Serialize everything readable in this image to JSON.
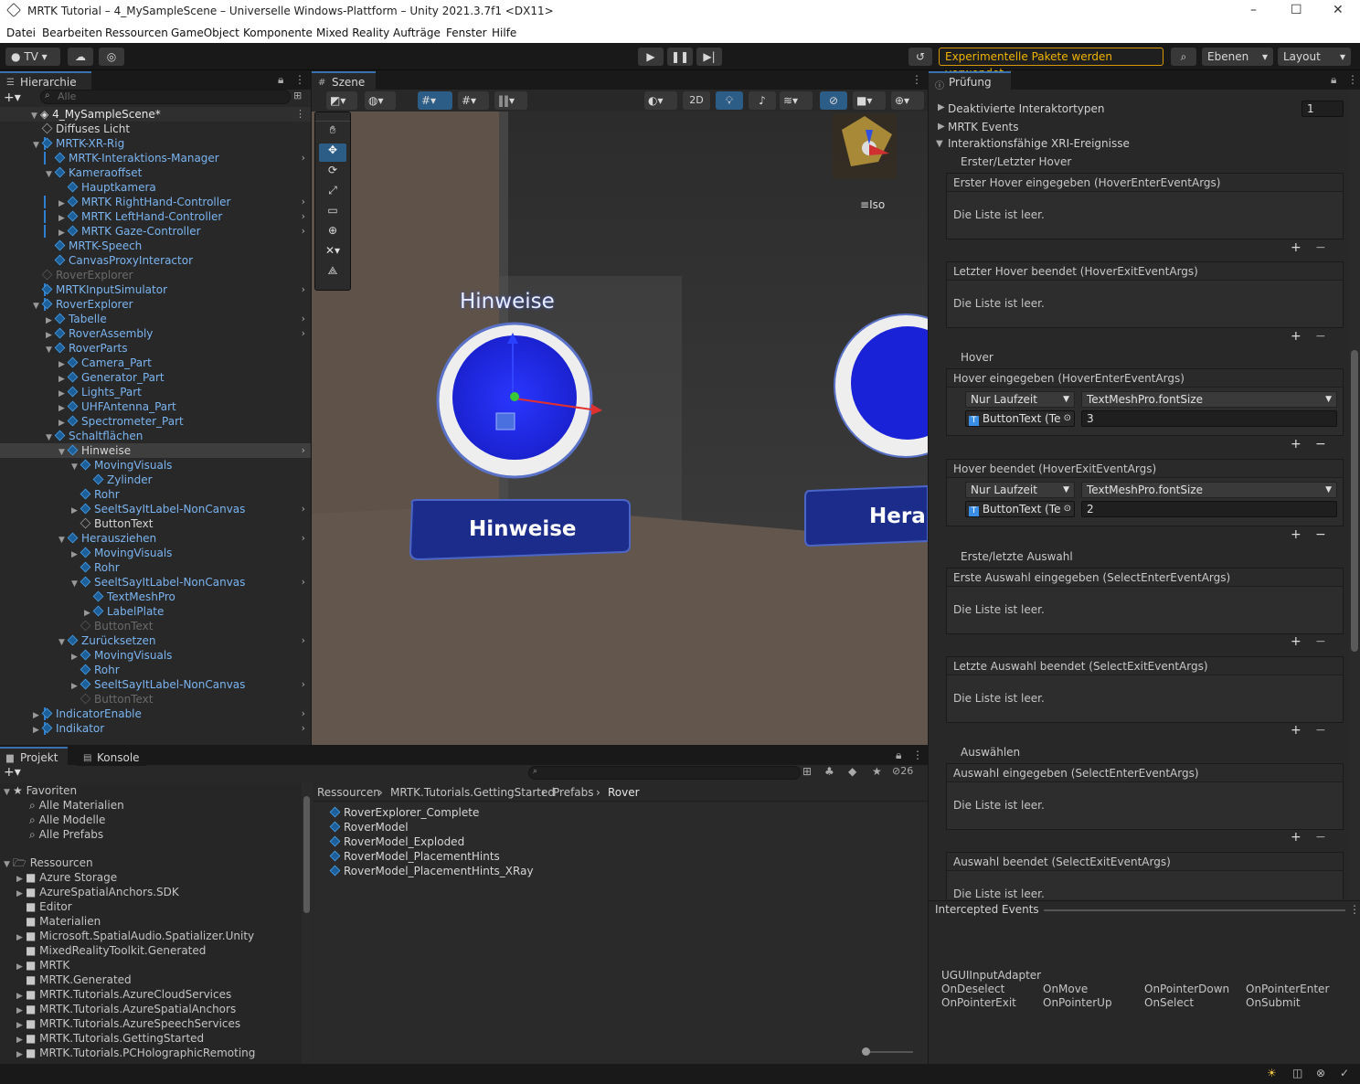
{
  "window": {
    "title": "MRTK Tutorial – 4_MySampleScene – Universelle Windows-Plattform – Unity 2021.3.7f1 <DX11>",
    "min": "–",
    "max": "☐",
    "close": "✕"
  },
  "menu": [
    "Datei",
    "Bearbeiten",
    "Ressourcen",
    "GameObject",
    "Komponente",
    "Mixed Reality",
    "Aufträge",
    "Fenster",
    "Hilfe"
  ],
  "toolbar": {
    "account": "TV",
    "warning": "Experimentelle Pakete werden verwendet",
    "layers": "Ebenen",
    "layout": "Layout"
  },
  "hierarchy": {
    "tab": "Hierarchie",
    "search_placeholder": "Alle",
    "scene": "4_MySampleScene*",
    "items": [
      {
        "label": "Diffuses Licht",
        "style": "normal"
      },
      {
        "label": "MRTK-XR-Rig",
        "style": "blue"
      },
      {
        "label": "MRTK-Interaktions-Manager",
        "style": "blue"
      },
      {
        "label": "Kameraoffset",
        "style": "blue"
      },
      {
        "label": "Hauptkamera",
        "style": "blue"
      },
      {
        "label": "MRTK RightHand-Controller",
        "style": "blue"
      },
      {
        "label": "MRTK LeftHand-Controller",
        "style": "blue"
      },
      {
        "label": "MRTK Gaze-Controller",
        "style": "blue"
      },
      {
        "label": "MRTK-Speech",
        "style": "blue"
      },
      {
        "label": "CanvasProxyInteractor",
        "style": "blue"
      },
      {
        "label": "RoverExplorer",
        "style": "dim"
      },
      {
        "label": "MRTKInputSimulator",
        "style": "blue"
      },
      {
        "label": "RoverExplorer",
        "style": "blue"
      },
      {
        "label": "Tabelle",
        "style": "blue"
      },
      {
        "label": "RoverAssembly",
        "style": "blue"
      },
      {
        "label": "RoverParts",
        "style": "blue"
      },
      {
        "label": "Camera_Part",
        "style": "blue"
      },
      {
        "label": "Generator_Part",
        "style": "blue"
      },
      {
        "label": "Lights_Part",
        "style": "blue"
      },
      {
        "label": "UHFAntenna_Part",
        "style": "blue"
      },
      {
        "label": "Spectrometer_Part",
        "style": "blue"
      },
      {
        "label": "Schaltflächen",
        "style": "blue"
      },
      {
        "label": "Hinweise",
        "style": "normal"
      },
      {
        "label": "MovingVisuals",
        "style": "blue"
      },
      {
        "label": "Zylinder",
        "style": "blue"
      },
      {
        "label": "Rohr",
        "style": "blue"
      },
      {
        "label": "SeeltSayItLabel-NonCanvas",
        "style": "blue"
      },
      {
        "label": "ButtonText",
        "style": "normal"
      },
      {
        "label": "Herausziehen",
        "style": "blue"
      },
      {
        "label": "MovingVisuals",
        "style": "blue"
      },
      {
        "label": "Rohr",
        "style": "blue"
      },
      {
        "label": "SeeltSayItLabel-NonCanvas",
        "style": "blue"
      },
      {
        "label": "TextMeshPro",
        "style": "blue"
      },
      {
        "label": "LabelPlate",
        "style": "blue"
      },
      {
        "label": "ButtonText",
        "style": "dim"
      },
      {
        "label": "Zurücksetzen",
        "style": "blue"
      },
      {
        "label": "MovingVisuals",
        "style": "blue"
      },
      {
        "label": "Rohr",
        "style": "blue"
      },
      {
        "label": "SeeltSayItLabel-NonCanvas",
        "style": "blue"
      },
      {
        "label": "ButtonText",
        "style": "dim"
      },
      {
        "label": "IndicatorEnable",
        "style": "blue"
      },
      {
        "label": "Indikator",
        "style": "blue"
      }
    ]
  },
  "scene": {
    "tab": "Szene",
    "mode_2d": "2D",
    "iso": "Iso",
    "label_top": "Hinweise",
    "button_label": "Hinweise",
    "button_label_2": "Hera"
  },
  "inspector": {
    "tab": "Prüfung",
    "deactivated": "Deaktivierte Interaktortypen",
    "deactivated_value": "1",
    "events": "MRTK Events",
    "xri": "Interaktionsfähige XRI-Ereignisse",
    "group1": "Erster/Letzter Hover",
    "box1": "Erster Hover eingegeben (HoverEnterEventArgs)",
    "empty": "Die Liste ist leer.",
    "box2": "Letzter Hover beendet (HoverExitEventArgs)",
    "group2": "Hover",
    "box3": "Hover eingegeben (HoverEnterEventArgs)",
    "runtime": "Nur Laufzeit",
    "func": "TextMeshPro.fontSize",
    "target": "ButtonText (Te",
    "val3": "3",
    "box4": "Hover beendet (HoverExitEventArgs)",
    "val4": "2",
    "group3": "Erste/letzte Auswahl",
    "box5": "Erste Auswahl eingegeben (SelectEnterEventArgs)",
    "box6": "Letzte Auswahl beendet (SelectExitEventArgs)",
    "group4": "Auswählen",
    "box7": "Auswahl eingegeben (SelectEnterEventArgs)",
    "box8": "Auswahl beendet (SelectExitEventArgs)",
    "plus": "+",
    "minus": "−",
    "intercepted": "Intercepted Events",
    "adapter": "UGUIInputAdapter",
    "event_names": [
      "OnDeselect",
      "OnMove",
      "OnPointerDown",
      "OnPointerEnter",
      "OnPointerExit",
      "OnPointerUp",
      "OnSelect",
      "OnSubmit"
    ]
  },
  "project": {
    "tab_project": "Projekt",
    "tab_console": "Konsole",
    "hidden_count": "26",
    "favorites": "Favoriten",
    "fav_items": [
      "Alle Materialien",
      "Alle Modelle",
      "Alle Prefabs"
    ],
    "resources": "Ressourcen",
    "folders": [
      "Azure Storage",
      "AzureSpatialAnchors.SDK",
      "Editor",
      "Materialien",
      "Microsoft.SpatialAudio.Spatializer.Unity",
      "MixedRealityToolkit.Generated",
      "MRTK",
      "MRTK.Generated",
      "MRTK.Tutorials.AzureCloudServices",
      "MRTK.Tutorials.AzureSpatialAnchors",
      "MRTK.Tutorials.AzureSpeechServices",
      "MRTK.Tutorials.GettingStarted",
      "MRTK.Tutorials.PCHolographicRemoting"
    ],
    "breadcrumb": [
      "Ressourcen",
      "MRTK.Tutorials.GettingStarted",
      "Prefabs",
      "Rover"
    ],
    "assets": [
      "RoverExplorer_Complete",
      "RoverModel",
      "RoverModel_Exploded",
      "RoverModel_PlacementHints",
      "RoverModel_PlacementHints_XRay"
    ]
  }
}
